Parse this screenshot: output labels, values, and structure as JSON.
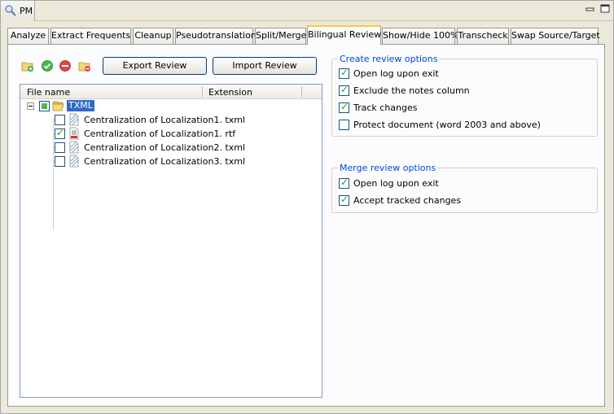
{
  "app": {
    "title": "PM"
  },
  "tabs": [
    {
      "label": "Analyze"
    },
    {
      "label": "Extract Frequents"
    },
    {
      "label": "Cleanup"
    },
    {
      "label": "Pseudotranslation"
    },
    {
      "label": "Split/Merge"
    },
    {
      "label": "Bilingual Review",
      "active": true
    },
    {
      "label": "Show/Hide 100%"
    },
    {
      "label": "Transcheck"
    },
    {
      "label": "Swap Source/Target"
    }
  ],
  "toolbar": {
    "icons": [
      "add-folder-icon",
      "check-all-icon",
      "remove-icon",
      "remove-folder-icon"
    ],
    "export_label": "Export Review",
    "import_label": "Import Review"
  },
  "file_list": {
    "columns": [
      "File name",
      "Extension"
    ],
    "root": {
      "label": "TXML",
      "state": "partial",
      "expanded": true
    },
    "files": [
      {
        "name": "Centralization of Localization1. txml",
        "checked": false,
        "icon": "txml-file-icon"
      },
      {
        "name": "Centralization of Localization1. rtf",
        "checked": true,
        "icon": "rtf-file-icon"
      },
      {
        "name": "Centralization of Localization2. txml",
        "checked": false,
        "icon": "txml-file-icon"
      },
      {
        "name": "Centralization of Localization3. txml",
        "checked": false,
        "icon": "txml-file-icon"
      }
    ]
  },
  "create_options": {
    "title": "Create review options",
    "items": [
      {
        "label": "Open log upon exit",
        "checked": true
      },
      {
        "label": "Exclude the notes column",
        "checked": true
      },
      {
        "label": "Track changes",
        "checked": true
      },
      {
        "label": "Protect document (word 2003 and above)",
        "checked": false
      }
    ]
  },
  "merge_options": {
    "title": "Merge review options",
    "items": [
      {
        "label": "Open log upon exit",
        "checked": true
      },
      {
        "label": "Accept tracked changes",
        "checked": true
      }
    ]
  },
  "colors": {
    "accent": "#316ac5",
    "group_title": "#0046d5",
    "active_tab": "#ffc83c",
    "background": "#ece9d8"
  }
}
